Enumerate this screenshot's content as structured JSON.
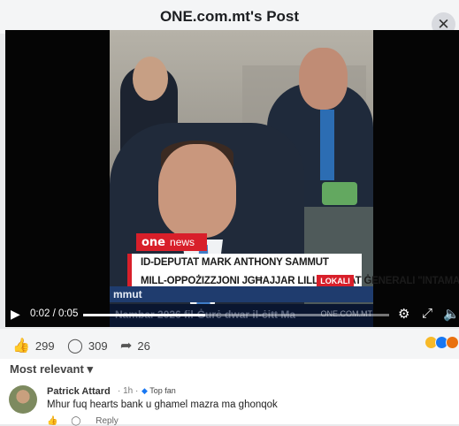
{
  "header": {
    "title": "ONE.com.mt's Post"
  },
  "video": {
    "brand": "one",
    "brand_label": "news",
    "headline_line1": "ID-DEPUTAT MARK ANTHONY SAMMUT",
    "headline_line2": "MILL-OPPOŻIZZJONI JGĦAJJAR LILL-AVUKAT ĠENERALI \"INTAMATA\"",
    "lokali": "LOKALI",
    "ticker": "mmut",
    "ghost": "Nambar 2026 fil-Ġurċ dwar il-ċitt Ma",
    "watermark": "ONE.COM.MT",
    "time": "0:02 / 0:05",
    "progress": 0.4
  },
  "reactions": {
    "likes": "299",
    "comments": "309",
    "shares": "26"
  },
  "comments": {
    "sort_label": "Most relevant",
    "items": [
      {
        "author": "Patrick Attard",
        "age": "1h",
        "badge": "Top fan",
        "text": "Mhur fuq hearts bank u ghamel mazra ma ghonqok",
        "reply": "Reply"
      }
    ]
  },
  "colors": {
    "brand_red": "#d81f2a",
    "ticker_blue": "#1f3c6e"
  }
}
